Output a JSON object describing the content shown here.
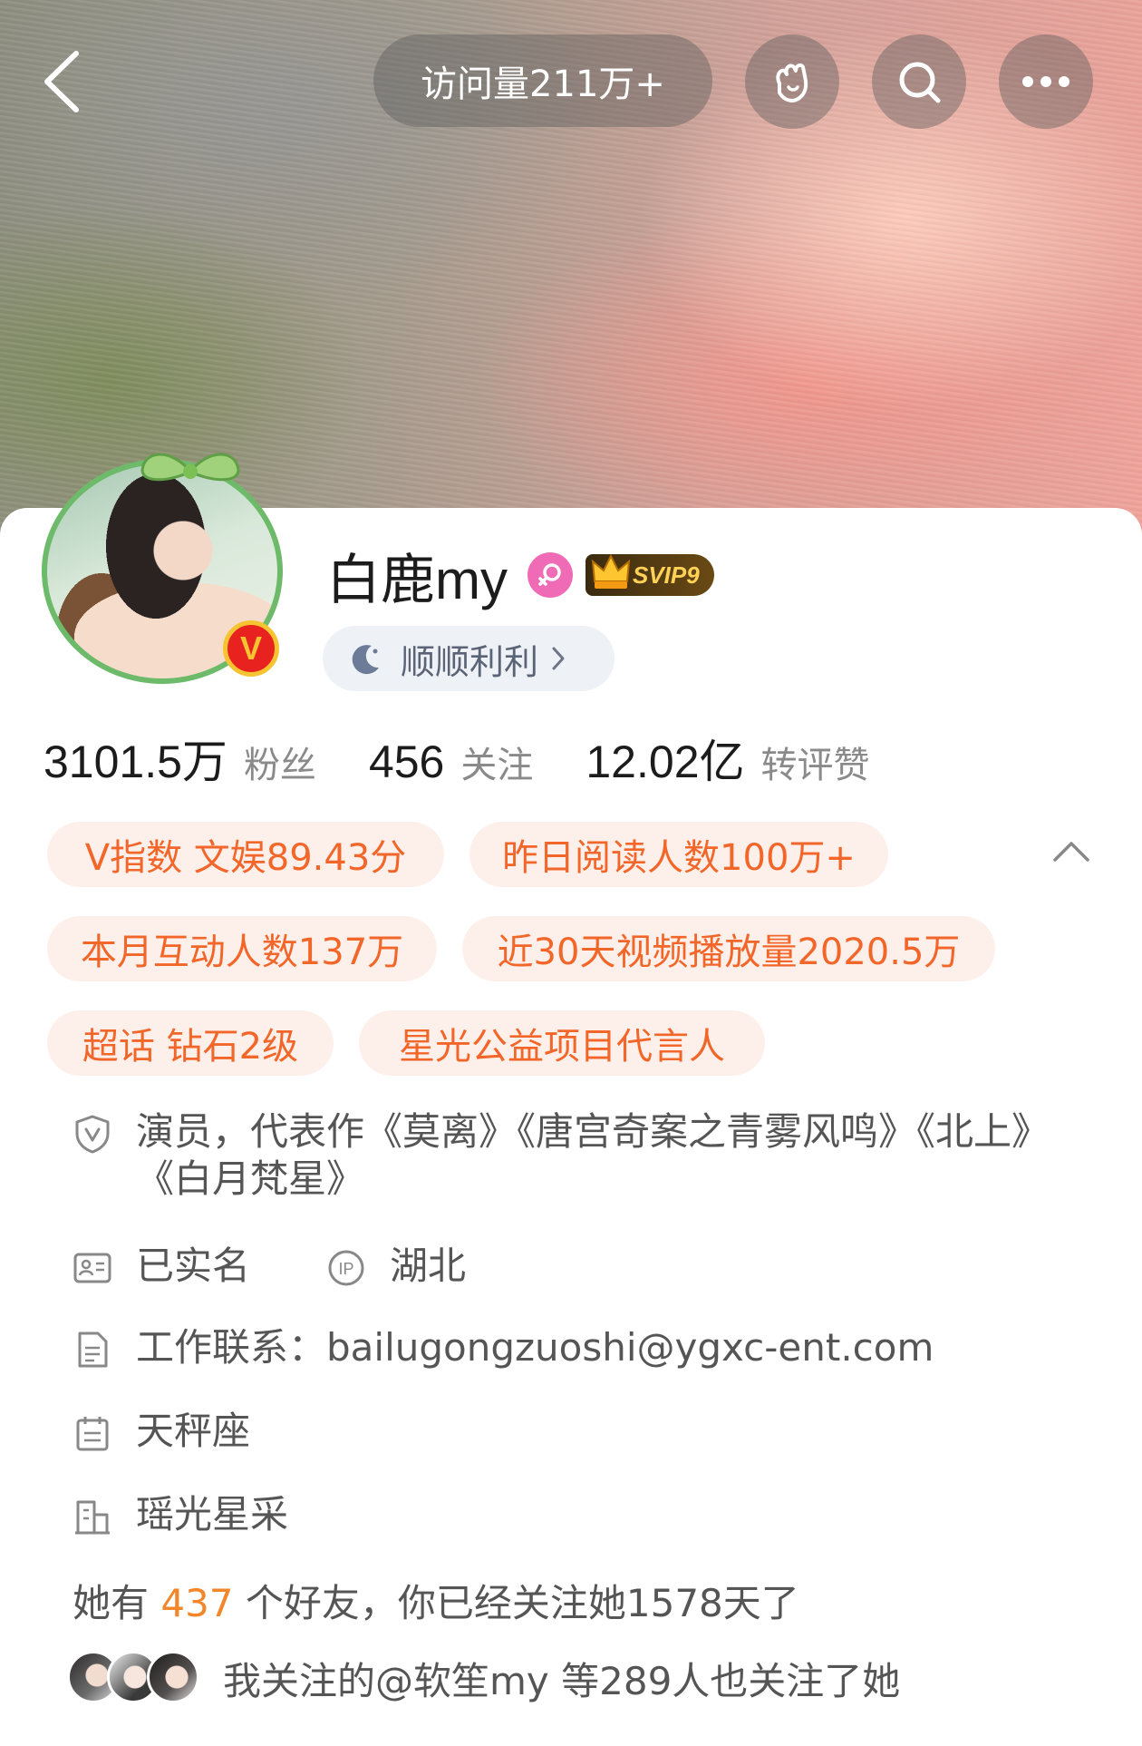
{
  "header": {
    "visits_label": "访问量211万+",
    "icons": [
      "chevron-left-icon",
      "wave-hand-icon",
      "search-icon",
      "more-icon"
    ]
  },
  "profile": {
    "username": "白鹿my",
    "gender": "female",
    "svip_label": "SVIP9",
    "mood_text": "顺顺利利"
  },
  "stats": [
    {
      "value": "3101.5万",
      "label": "粉丝"
    },
    {
      "value": "456",
      "label": "关注"
    },
    {
      "value": "12.02亿",
      "label": "转评赞"
    }
  ],
  "tags": [
    "V指数 文娱89.43分",
    "昨日阅读人数100万+",
    "本月互动人数137万",
    "近30天视频播放量2020.5万",
    "超话 钻石2级",
    "星光公益项目代言人"
  ],
  "info": {
    "bio": "演员，代表作《莫离》《唐宫奇案之青雾风鸣》《北上》《白月梵星》",
    "verified_name": "已实名",
    "ip_location": "湖北",
    "work_contact": "工作联系：bailugongzuoshi@ygxc-ent.com",
    "zodiac": "天秤座",
    "company": "瑶光星采"
  },
  "friends": {
    "prefix": "她有 ",
    "count": "437",
    "suffix": " 个好友，你已经关注她1578天了"
  },
  "mutual_follow_text": "我关注的@软笙my 等289人也关注了她",
  "colors": {
    "accent_orange": "#f2662a",
    "tag_bg": "#fdf0ea",
    "verified_red": "#e8231f",
    "gender_pink": "#f06bb6"
  }
}
